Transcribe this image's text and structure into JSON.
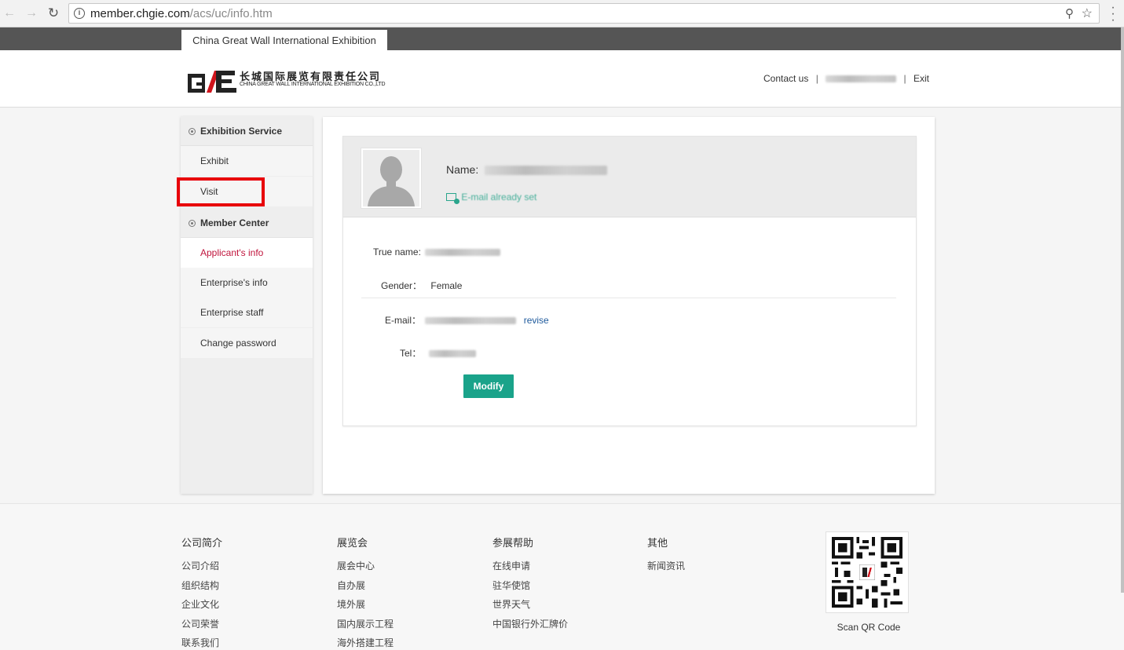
{
  "browser": {
    "url_host": "member.chgie.com",
    "url_path": "/acs/uc/info.htm"
  },
  "topbar": {
    "tab_label": "China Great Wall International Exhibition"
  },
  "header": {
    "logo_cn": "长城国际展览有限责任公司",
    "logo_en": "CHINA GREAT WALL INTERNATIONAL EXHIBITION CO.,LTD",
    "contact_label": "Contact us",
    "exit_label": "Exit"
  },
  "sidebar": {
    "groups": [
      {
        "label": "Exhibition Service",
        "items": [
          "Exhibit",
          "Visit"
        ]
      },
      {
        "label": "Member Center",
        "items": [
          "Applicant's info",
          "Enterprise's info",
          "Enterprise staff",
          "Change password"
        ]
      }
    ],
    "active_item": "Applicant's info"
  },
  "profile": {
    "name_label": "Name:",
    "email_status": "E-mail already set",
    "fields": {
      "true_name_label": "True name:",
      "gender_label": "Gender：",
      "gender_value": "Female",
      "email_label": "E-mail：",
      "revise_label": "revise",
      "tel_label": "Tel："
    },
    "modify_label": "Modify"
  },
  "footer": {
    "columns": [
      {
        "head": "公司简介",
        "links": [
          "公司介绍",
          "组织结构",
          "企业文化",
          "公司荣誉",
          "联系我们"
        ]
      },
      {
        "head": "展览会",
        "links": [
          "展会中心",
          "自办展",
          "境外展",
          "国内展示工程",
          "海外搭建工程"
        ]
      },
      {
        "head": "参展帮助",
        "links": [
          "在线申请",
          "驻华使馆",
          "世界天气",
          "中国银行外汇牌价"
        ]
      },
      {
        "head": "其他",
        "links": [
          "新闻资讯"
        ]
      }
    ],
    "qr_label": "Scan QR Code"
  },
  "colors": {
    "accent_green": "#1aa38a",
    "active_red": "#c0143c",
    "highlight_red": "#e8000a",
    "topbar_gray": "#555555"
  }
}
